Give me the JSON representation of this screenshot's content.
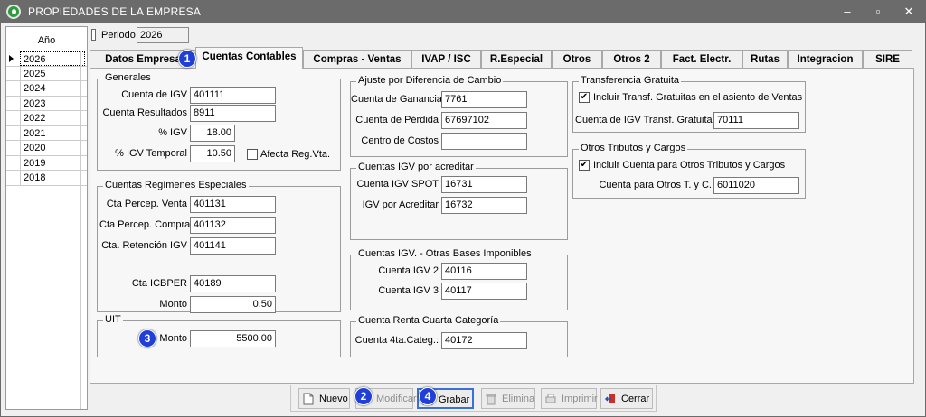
{
  "window": {
    "title": "PROPIEDADES DE LA EMPRESA",
    "minimize": "–",
    "maximize": "▫",
    "close": "✕"
  },
  "year_grid": {
    "header": "Año",
    "years": [
      "2026",
      "2025",
      "2024",
      "2023",
      "2022",
      "2021",
      "2020",
      "2019",
      "2018"
    ],
    "selected": "2026"
  },
  "periodo": {
    "label": "Periodo",
    "value": "2026"
  },
  "tabs": [
    "Datos Empresa",
    "Cuentas Contables",
    "Compras - Ventas",
    "IVAP / ISC",
    "R.Especial",
    "Otros",
    "Otros 2",
    "Fact. Electr.",
    "Rutas",
    "Integracion",
    "SIRE"
  ],
  "active_tab": "Cuentas Contables",
  "generales": {
    "title": "Generales",
    "cuenta_igv_label": "Cuenta de IGV",
    "cuenta_igv": "401111",
    "cuenta_resultados_label": "Cuenta Resultados",
    "cuenta_resultados": "8911",
    "pct_igv_label": "% IGV",
    "pct_igv": "18.00",
    "pct_igv_temporal_label": "% IGV Temporal",
    "pct_igv_temporal": "10.50",
    "afecta_label": "Afecta Reg.Vta.",
    "afecta_checked": false
  },
  "regimenes": {
    "title": "Cuentas Regímenes Especiales",
    "percep_venta_label": "Cta Percep. Venta",
    "percep_venta": "401131",
    "percep_compra_label": "Cta Percep. Compra",
    "percep_compra": "401132",
    "retencion_label": "Cta. Retención IGV",
    "retencion": "401141",
    "icbper_label": "Cta ICBPER",
    "icbper": "40189",
    "monto_label": "Monto",
    "monto": "0.50"
  },
  "uit": {
    "title": "UIT",
    "monto_label": "Monto",
    "monto": "5500.00"
  },
  "ajuste": {
    "title": "Ajuste por Diferencia de Cambio",
    "ganancia_label": "Cuenta de Ganancia",
    "ganancia": "7761",
    "perdida_label": "Cuenta de Pérdida",
    "perdida": "67697102",
    "centro_label": "Centro de Costos",
    "centro": ""
  },
  "igv_acreditar": {
    "title": "Cuentas IGV por acreditar",
    "spot_label": "Cuenta IGV SPOT",
    "spot": "16731",
    "acreditar_label": "IGV por Acreditar",
    "acreditar": "16732"
  },
  "otras_bases": {
    "title": "Cuentas IGV. - Otras Bases Imponibles",
    "igv2_label": "Cuenta IGV 2",
    "igv2": "40116",
    "igv3_label": "Cuenta IGV 3",
    "igv3": "40117"
  },
  "renta": {
    "title": "Cuenta Renta Cuarta Categoría",
    "label": "Cuenta 4ta.Categ.:",
    "value": "40172"
  },
  "transferencia": {
    "title": "Transferencia Gratuita",
    "check_label": "Incluir Transf. Gratuitas en el asiento de Ventas",
    "checked": true,
    "cuenta_label": "Cuenta de IGV Transf. Gratuita",
    "cuenta": "70111"
  },
  "otros_tributos": {
    "title": "Otros Tributos y Cargos",
    "check_label": "Incluir Cuenta para Otros Tributos y Cargos",
    "checked": true,
    "cuenta_label": "Cuenta para Otros T. y C.",
    "cuenta": "6011020"
  },
  "buttons": {
    "nuevo": "Nuevo",
    "modificar": "Modificar",
    "grabar": "Grabar",
    "elimina": "Elimina",
    "imprimir": "Imprimir",
    "cerrar": "Cerrar"
  },
  "badges": {
    "b1": "1",
    "b2": "2",
    "b3": "3",
    "b4": "4"
  },
  "colors": {
    "titlebar": "#6b6b6b",
    "badge": "#1f3fd6",
    "panel": "#f7f7f7",
    "cerrar_icon": "#c8312a"
  }
}
